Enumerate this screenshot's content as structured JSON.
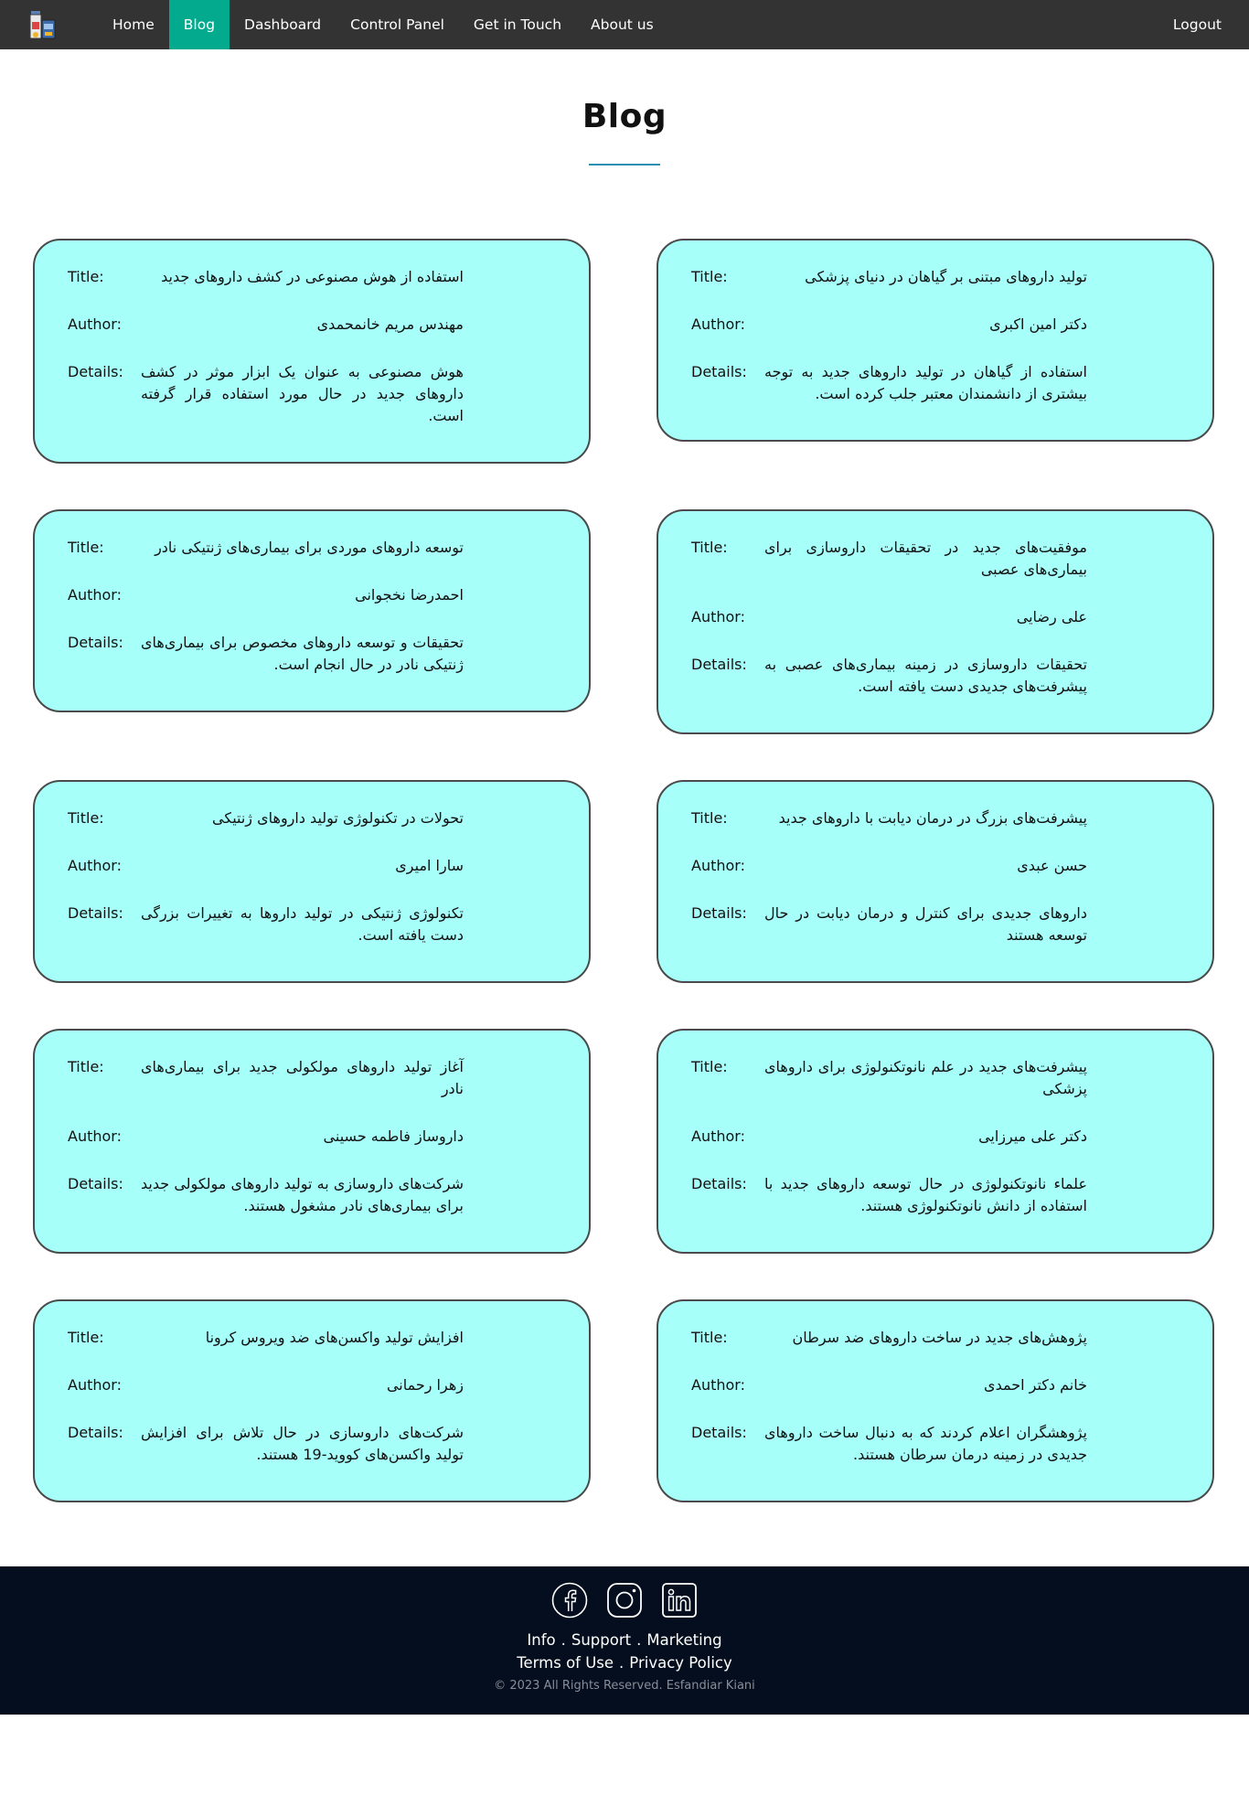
{
  "nav": {
    "items": [
      {
        "label": "Home",
        "active": false
      },
      {
        "label": "Blog",
        "active": true
      },
      {
        "label": "Dashboard",
        "active": false
      },
      {
        "label": "Control Panel",
        "active": false
      },
      {
        "label": "Get in Touch",
        "active": false
      },
      {
        "label": "About us",
        "active": false
      }
    ],
    "logout": "Logout",
    "active_color": "#04AA8D",
    "bg_color": "#333333"
  },
  "page": {
    "title": "Blog",
    "labels": {
      "title": "Title:",
      "author": "Author:",
      "details": "Details:"
    }
  },
  "posts": [
    {
      "title": "استفاده از هوش مصنوعی در کشف داروهای جدید",
      "author": "مهندس مریم خانمحمدی",
      "details": "هوش مصنوعی به عنوان یک ابزار موثر در کشف داروهای جدید در حال مورد استفاده قرار گرفته است."
    },
    {
      "title": "تولید داروهای مبتنی بر گیاهان در دنیای پزشکی",
      "author": "دکتر امین اکبری",
      "details": "استفاده از گیاهان در تولید داروهای جدید به توجه بیشتری از دانشمندان معتبر جلب کرده است."
    },
    {
      "title": "توسعه داروهای موردی برای بیماری‌های ژنتیکی نادر",
      "author": "احمدرضا نخجوانی",
      "details": "تحقیقات و توسعه داروهای مخصوص برای بیماری‌های ژنتیکی نادر در حال انجام است."
    },
    {
      "title": "موفقیت‌های جدید در تحقیقات داروسازی برای بیماری‌های عصبی",
      "author": "علی رضایی",
      "details": "تحقیقات داروسازی در زمینه بیماری‌های عصبی به پیشرفت‌های جدیدی دست یافته است."
    },
    {
      "title": "تحولات در تکنولوژی تولید داروهای ژنتیکی",
      "author": "سارا امیری",
      "details": "تکنولوژی ژنتیکی در تولید داروها به تغییرات بزرگی دست یافته است."
    },
    {
      "title": "پیشرفت‌های بزرگ در درمان دیابت با داروهای جدید",
      "author": "حسن عبدی",
      "details": "داروهای جدیدی برای کنترل و درمان دیابت در حال توسعه هستند"
    },
    {
      "title": "آغاز تولید داروهای مولکولی جدید برای بیماری‌های نادر",
      "author": "داروساز فاطمه حسینی",
      "details": "شرکت‌های داروسازی به تولید داروهای مولکولی جدید برای بیماری‌های نادر مشغول هستند."
    },
    {
      "title": "پیشرفت‌های جدید در علم نانوتکنولوژی برای داروهای پزشکی",
      "author": "دکتر علی میرزایی",
      "details": "علماء نانوتکنولوژی در حال توسعه داروهای جدید با استفاده از دانش نانوتکنولوژی هستند."
    },
    {
      "title": "افزایش تولید واکسن‌های ضد ویروس کرونا",
      "author": "زهرا رحمانی",
      "details": "شرکت‌های داروسازی در حال تلاش برای افزایش تولید واکسن‌های کووید-19 هستند."
    },
    {
      "title": "پژوهش‌های جدید در ساخت داروهای ضد سرطان",
      "author": "خانم دکتر احمدی",
      "details": "پژوهشگران اعلام کردند که به دنبال ساخت داروهای جدیدی در زمینه درمان سرطان هستند."
    }
  ],
  "footer": {
    "socials": [
      "facebook-icon",
      "instagram-icon",
      "linkedin-icon"
    ],
    "links1": [
      "Info",
      "Support",
      "Marketing"
    ],
    "links2": [
      "Terms of Use",
      "Privacy Policy"
    ],
    "separator": ".",
    "copyright": "© 2023 All Rights Reserved. Esfandiar Kiani"
  },
  "colors": {
    "card_bg": "#a7fffa",
    "card_border": "#4a4a4a",
    "title_rule": "#2b8fb3",
    "footer_bg": "#050e1e"
  }
}
